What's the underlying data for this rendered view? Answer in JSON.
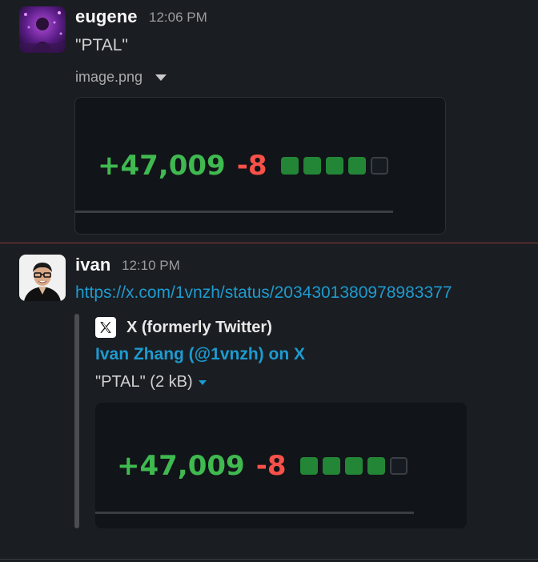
{
  "messages": [
    {
      "sender": "eugene",
      "time": "12:06 PM",
      "text": "\"PTAL\"",
      "attachment": {
        "file_name": "image.png",
        "stats": {
          "additions": "+47,009",
          "deletions": "-8"
        }
      }
    },
    {
      "sender": "ivan",
      "time": "12:10 PM",
      "link": "https://x.com/1vnzh/status/2034301380978983377",
      "unfurl": {
        "site_name": "X (formerly Twitter)",
        "site_icon": "x-logo-icon",
        "title": "Ivan Zhang (@1vnzh) on X",
        "description": "\"PTAL\" (2 kB)",
        "stats": {
          "additions": "+47,009",
          "deletions": "-8"
        }
      }
    }
  ],
  "diff_blocks": [
    "green",
    "green",
    "green",
    "green",
    "empty"
  ],
  "colors": {
    "background": "#1a1d21",
    "link": "#1d9bd1",
    "additions": "#3fb950",
    "deletions": "#f85149",
    "block_green": "#238636",
    "unread_divider": "#8a3a3a"
  }
}
